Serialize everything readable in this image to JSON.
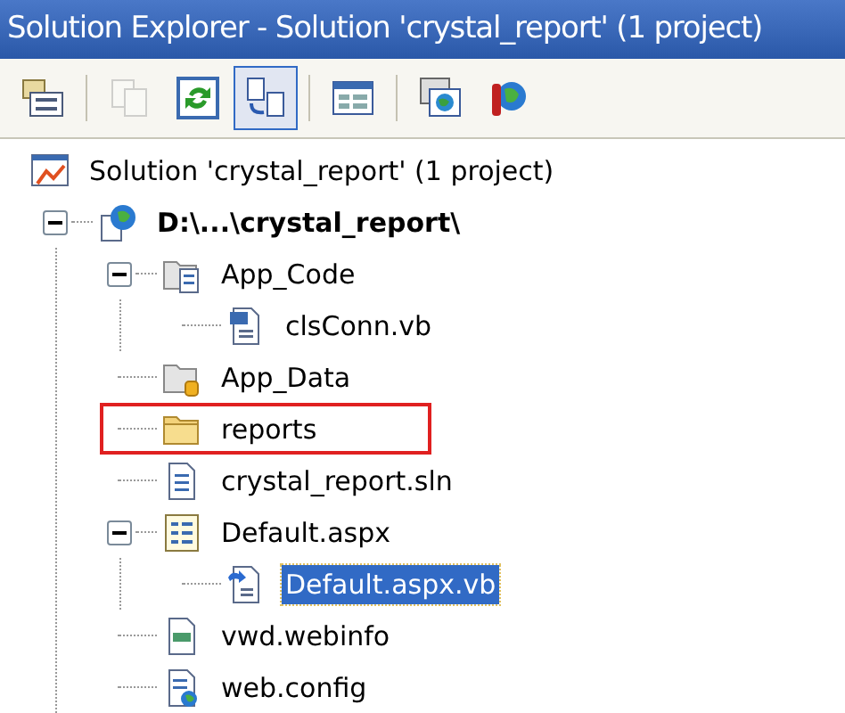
{
  "window": {
    "title": "Solution Explorer - Solution 'crystal_report' (1 project)"
  },
  "toolbar": [
    {
      "kind": "properties",
      "pressed": false,
      "disabled": false
    },
    {
      "kind": "copy",
      "pressed": false,
      "disabled": true
    },
    {
      "kind": "refresh",
      "pressed": false,
      "disabled": false
    },
    {
      "kind": "nest",
      "pressed": true,
      "disabled": false
    },
    {
      "kind": "designer",
      "pressed": false,
      "disabled": false
    },
    {
      "kind": "browser",
      "pressed": false,
      "disabled": false
    },
    {
      "kind": "config",
      "pressed": false,
      "disabled": false
    }
  ],
  "tree": {
    "kind": "solution",
    "label": "Solution 'crystal_report' (1 project)",
    "selected": false,
    "highlighted": false,
    "children": [
      {
        "kind": "project",
        "label": "D:\\...\\crystal_report\\",
        "selected": false,
        "highlighted": false,
        "expanded": true,
        "children": [
          {
            "kind": "code-folder",
            "label": "App_Code",
            "selected": false,
            "highlighted": false,
            "expanded": true,
            "children": [
              {
                "kind": "vb",
                "label": "clsConn.vb",
                "selected": false,
                "highlighted": false
              }
            ]
          },
          {
            "kind": "data-folder",
            "label": "App_Data",
            "selected": false,
            "highlighted": false
          },
          {
            "kind": "folder",
            "label": "reports",
            "selected": false,
            "highlighted": true
          },
          {
            "kind": "sln",
            "label": "crystal_report.sln",
            "selected": false,
            "highlighted": false
          },
          {
            "kind": "aspx",
            "label": "Default.aspx",
            "selected": false,
            "highlighted": false,
            "expanded": true,
            "children": [
              {
                "kind": "codebehind",
                "label": "Default.aspx.vb",
                "selected": true,
                "highlighted": false
              }
            ]
          },
          {
            "kind": "webinfo",
            "label": "vwd.webinfo",
            "selected": false,
            "highlighted": false
          },
          {
            "kind": "config",
            "label": "web.config",
            "selected": false,
            "highlighted": false
          }
        ]
      }
    ]
  }
}
